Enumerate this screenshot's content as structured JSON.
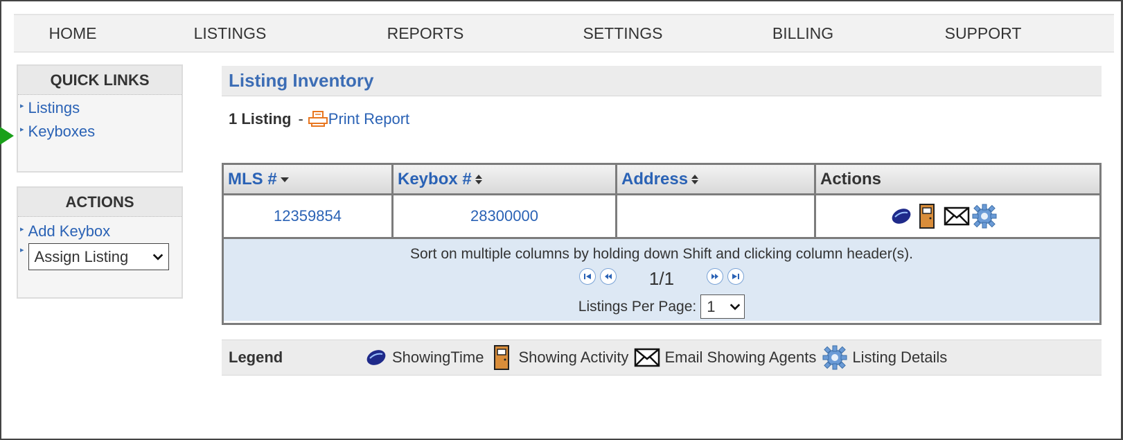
{
  "nav": {
    "items": [
      "HOME",
      "LISTINGS",
      "REPORTS",
      "SETTINGS",
      "BILLING",
      "SUPPORT"
    ]
  },
  "quick_links": {
    "title": "QUICK LINKS",
    "items": [
      "Listings",
      "Keyboxes"
    ]
  },
  "actions": {
    "title": "ACTIONS",
    "add_keybox": "Add Keybox",
    "assign_listing": "Assign Listing"
  },
  "inventory": {
    "title": "Listing Inventory",
    "count_label": "1 Listing",
    "separator": "-",
    "print_label": "Print Report"
  },
  "table": {
    "headers": [
      "MLS #",
      "Keybox #",
      "Address",
      "Actions"
    ],
    "rows": [
      {
        "mls": "12359854",
        "keybox": "28300000",
        "address": ""
      }
    ]
  },
  "pager": {
    "hint": "Sort on multiple columns by holding down Shift and clicking column header(s).",
    "page_indicator": "1/1",
    "per_page_label": "Listings Per Page:",
    "per_page_value": "1"
  },
  "legend": {
    "title": "Legend",
    "items": [
      "ShowingTime",
      "Showing Activity",
      "Email Showing Agents",
      "Listing Details"
    ]
  },
  "colors": {
    "link": "#2a62b5",
    "title": "#3c6db5",
    "pager_bg": "#dde8f4",
    "print_icon": "#e8761f",
    "marker": "#1aa01a"
  }
}
